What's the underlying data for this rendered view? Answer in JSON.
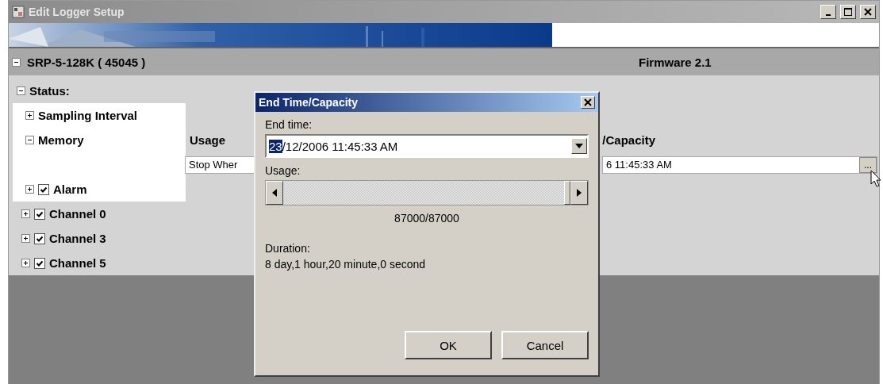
{
  "window": {
    "title": "Edit Logger Setup"
  },
  "device": {
    "name": "SRP-5-128K ( 45045 )",
    "firmware": "Firmware 2.1",
    "expanded": true
  },
  "tree": [
    {
      "label": "Status:",
      "kind": "plain",
      "expanded": true,
      "children": [
        {
          "label": "Sampling Interval",
          "kind": "plain",
          "expanded": false
        },
        {
          "label": "Memory",
          "kind": "plain",
          "expanded": true
        },
        {
          "label": "Alarm",
          "kind": "checkbox",
          "checked": true,
          "expanded": false
        }
      ]
    },
    {
      "label": "Channel 0",
      "kind": "checkbox",
      "checked": true,
      "expanded": false
    },
    {
      "label": "Channel 3",
      "kind": "checkbox",
      "checked": true,
      "expanded": false
    },
    {
      "label": "Channel 5",
      "kind": "checkbox",
      "checked": true,
      "expanded": false
    }
  ],
  "memory_columns": [
    {
      "header": "Usage",
      "value": "Stop Wher"
    },
    {
      "header": "/Capacity",
      "value": "6 11:45:33 AM",
      "button": "..."
    }
  ],
  "dialog": {
    "title": "End Time/Capacity",
    "end_time_label": "End time:",
    "end_time": [
      {
        "text": "23",
        "selected": true
      },
      {
        "text": "/12/2006 11:45:33 AM",
        "selected": false
      }
    ],
    "usage_label": "Usage:",
    "usage": {
      "level": 1
    },
    "usage_reading": "87000/87000",
    "duration_label": "Duration:",
    "duration": "8 day,1 hour,20 minute,0 second",
    "buttons": [
      "OK",
      "Cancel"
    ]
  }
}
